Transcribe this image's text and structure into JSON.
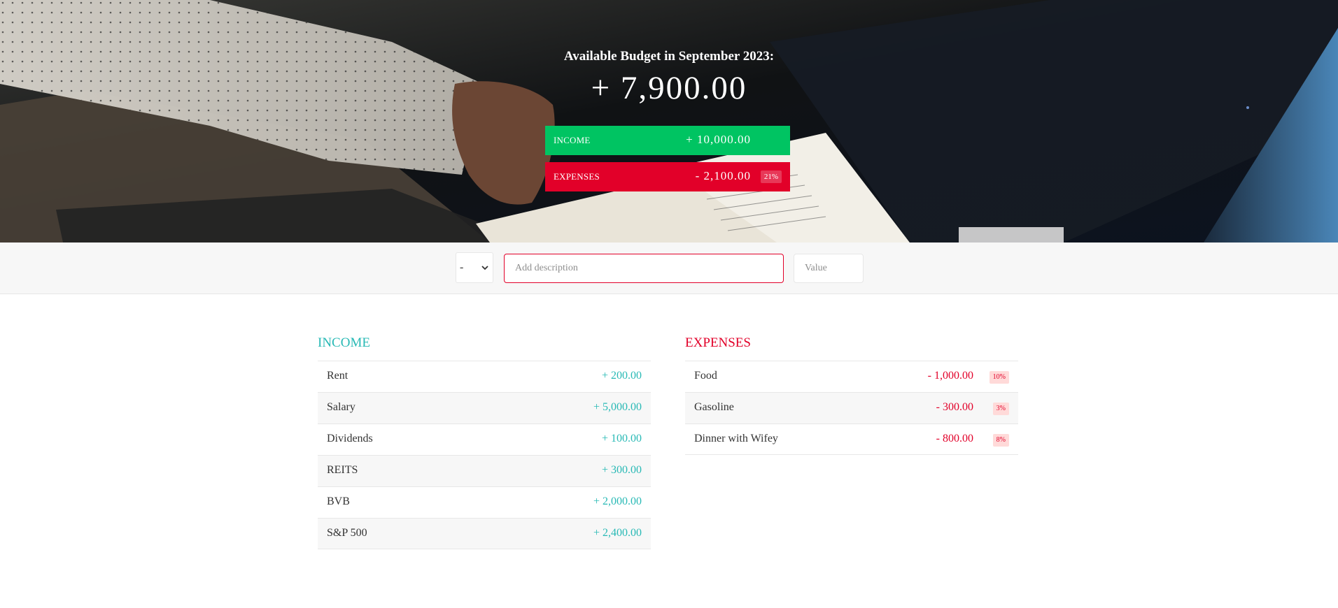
{
  "hero": {
    "title": "Available Budget in September 2023:",
    "value": "+ 7,900.00",
    "income": {
      "label": "INCOME",
      "value": "+ 10,000.00"
    },
    "expenses": {
      "label": "EXPENSES",
      "value": "- 2,100.00",
      "percentage": "21%"
    }
  },
  "add_bar": {
    "type_select": {
      "selected": "-",
      "options": [
        "-"
      ]
    },
    "description": {
      "placeholder": "Add description",
      "value": ""
    },
    "value": {
      "placeholder": "Value",
      "value": ""
    }
  },
  "income": {
    "title": "INCOME",
    "items": [
      {
        "description": "Rent",
        "value": "+ 200.00"
      },
      {
        "description": "Salary",
        "value": "+ 5,000.00"
      },
      {
        "description": "Dividends",
        "value": "+ 100.00"
      },
      {
        "description": "REITS",
        "value": "+ 300.00"
      },
      {
        "description": "BVB",
        "value": "+ 2,000.00"
      },
      {
        "description": "S&P 500",
        "value": "+ 2,400.00"
      }
    ]
  },
  "expenses": {
    "title": "EXPENSES",
    "items": [
      {
        "description": "Food",
        "value": "- 1,000.00",
        "percentage": "10%"
      },
      {
        "description": "Gasoline",
        "value": "- 300.00",
        "percentage": "3%"
      },
      {
        "description": "Dinner with Wifey",
        "value": "- 800.00",
        "percentage": "8%"
      }
    ]
  },
  "colors": {
    "income_accent": "#00c462",
    "income_text": "#28b9b5",
    "expenses_accent": "#e20029",
    "percentage_bg": "#ffdad9",
    "hero_bg": "#0b0d10"
  }
}
